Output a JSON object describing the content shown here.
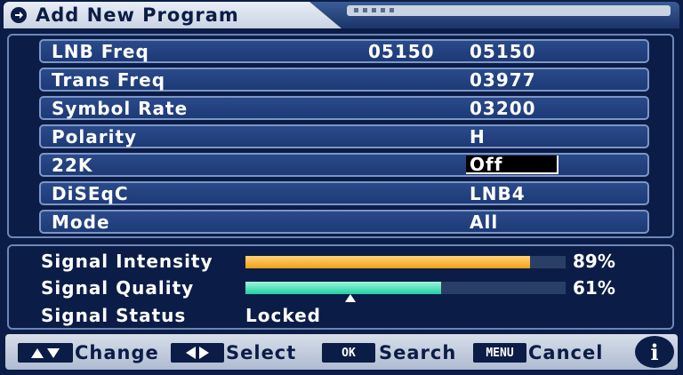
{
  "header": {
    "title": "Add New Program"
  },
  "settings": [
    {
      "label": "LNB Freq",
      "value1": "05150",
      "value2": "05150"
    },
    {
      "label": "Trans Freq",
      "value1": "",
      "value2": "03977"
    },
    {
      "label": "Symbol Rate",
      "value1": "",
      "value2": "03200"
    },
    {
      "label": "Polarity",
      "value1": "",
      "value2": "H"
    },
    {
      "label": "22K",
      "value1": "",
      "value2": "Off"
    },
    {
      "label": "DiSEqC",
      "value1": "",
      "value2": "LNB4"
    },
    {
      "label": "Mode",
      "value1": "",
      "value2": "All"
    }
  ],
  "signal": {
    "intensity": {
      "label": "Signal Intensity",
      "value": 89,
      "text": "89%"
    },
    "quality": {
      "label": "Signal Quality",
      "value": 61,
      "text": "61%"
    },
    "status": {
      "label": "Signal Status",
      "value": "Locked"
    }
  },
  "footer": {
    "change": "Change",
    "select": "Select",
    "ok_key": "OK",
    "search": "Search",
    "menu_key": "MENU",
    "cancel": "Cancel",
    "info": "i"
  },
  "colors": {
    "background": "#0b1d46",
    "row": "#1d3a76",
    "intensity_bar": "#f3a114",
    "quality_bar": "#1fd0a5"
  }
}
